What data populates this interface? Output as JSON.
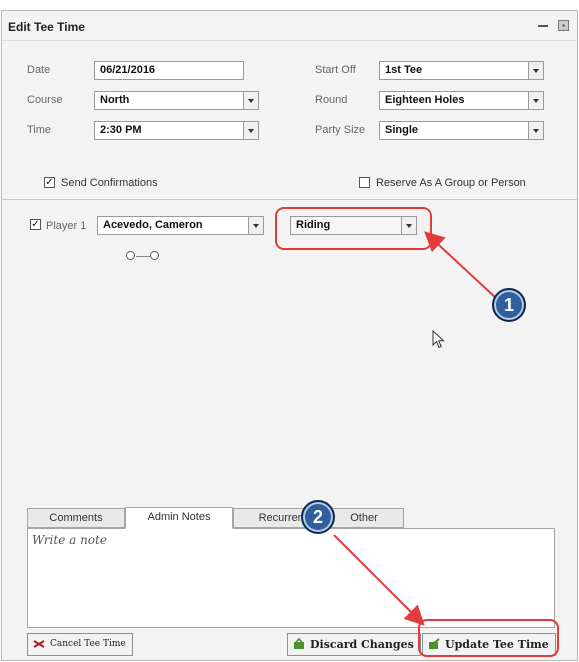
{
  "dialog": {
    "title": "Edit Tee Time"
  },
  "form": {
    "date_label": "Date",
    "date_value": "06/21/2016",
    "course_label": "Course",
    "course_value": "North",
    "time_label": "Time",
    "time_value": "2:30 PM",
    "start_label": "Start Off",
    "start_value": "1st Tee",
    "round_label": "Round",
    "round_value": "Eighteen Holes",
    "party_label": "Party Size",
    "party_value": "Single"
  },
  "options": {
    "send_confirmations": {
      "label": "Send Confirmations",
      "checked": true
    },
    "reserve_group": {
      "label": "Reserve As A Group or Person",
      "checked": false
    }
  },
  "player": {
    "label": "Player 1",
    "checked": true,
    "name": "Acevedo, Cameron",
    "transport": "Riding"
  },
  "tabs": [
    {
      "label": "Comments"
    },
    {
      "label": "Admin Notes"
    },
    {
      "label": "Recurrence"
    },
    {
      "label": "Other"
    }
  ],
  "notes": {
    "placeholder": "Write a note"
  },
  "buttons": {
    "cancel": "Cancel Tee Time",
    "discard": "Discard Changes",
    "update": "Update Tee Time"
  },
  "annotations": {
    "badge1": "1",
    "badge2": "2",
    "color": "#e33b3b"
  }
}
